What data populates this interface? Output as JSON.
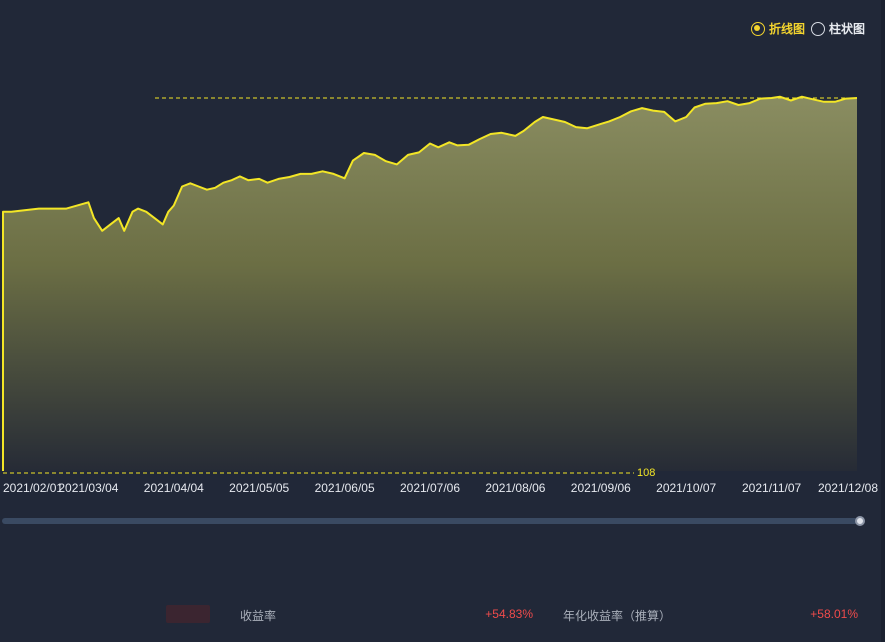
{
  "toggle": {
    "line_label": "折线图",
    "bar_label": "柱状图",
    "selected": "line"
  },
  "colors": {
    "line": "#f3e626",
    "background": "#212838",
    "gain": "#f04b4b"
  },
  "chart_data": {
    "type": "area",
    "ylim": [
      108,
      167
    ],
    "min_label": "108",
    "xticks": [
      "2021/02/01",
      "2021/03/04",
      "2021/04/04",
      "2021/05/05",
      "2021/06/05",
      "2021/07/06",
      "2021/08/06",
      "2021/09/06",
      "2021/10/07",
      "2021/11/07",
      "2021/12/08"
    ],
    "x": [
      "2021/02/01",
      "2021/02/04",
      "2021/02/14",
      "2021/02/24",
      "2021/03/04",
      "2021/03/06",
      "2021/03/09",
      "2021/03/12",
      "2021/03/15",
      "2021/03/17",
      "2021/03/20",
      "2021/03/22",
      "2021/03/25",
      "2021/03/28",
      "2021/03/31",
      "2021/04/02",
      "2021/04/04",
      "2021/04/07",
      "2021/04/10",
      "2021/04/13",
      "2021/04/16",
      "2021/04/19",
      "2021/04/22",
      "2021/04/25",
      "2021/04/28",
      "2021/05/01",
      "2021/05/05",
      "2021/05/08",
      "2021/05/12",
      "2021/05/16",
      "2021/05/20",
      "2021/05/24",
      "2021/05/28",
      "2021/06/01",
      "2021/06/05",
      "2021/06/08",
      "2021/06/12",
      "2021/06/16",
      "2021/06/20",
      "2021/06/24",
      "2021/06/28",
      "2021/07/02",
      "2021/07/06",
      "2021/07/09",
      "2021/07/13",
      "2021/07/16",
      "2021/07/20",
      "2021/07/24",
      "2021/07/28",
      "2021/08/01",
      "2021/08/06",
      "2021/08/09",
      "2021/08/13",
      "2021/08/16",
      "2021/08/20",
      "2021/08/24",
      "2021/08/28",
      "2021/09/01",
      "2021/09/06",
      "2021/09/09",
      "2021/09/13",
      "2021/09/17",
      "2021/09/21",
      "2021/09/25",
      "2021/09/29",
      "2021/10/03",
      "2021/10/07",
      "2021/10/10",
      "2021/10/14",
      "2021/10/18",
      "2021/10/22",
      "2021/10/26",
      "2021/10/30",
      "2021/11/03",
      "2021/11/07",
      "2021/11/10",
      "2021/11/14",
      "2021/11/18",
      "2021/11/22",
      "2021/11/26",
      "2021/11/30",
      "2021/12/04",
      "2021/12/08"
    ],
    "values": [
      149,
      149,
      149.5,
      149.5,
      150.5,
      148,
      146,
      147,
      148,
      146,
      149,
      149.5,
      149,
      148,
      147,
      149,
      150,
      153,
      153.5,
      153,
      152.5,
      152.8,
      153.6,
      154,
      154.6,
      154,
      154.2,
      153.6,
      154.2,
      154.5,
      155,
      155,
      155.4,
      155,
      154.3,
      157.1,
      158.3,
      158,
      157,
      156.5,
      158,
      158.4,
      159.8,
      159.2,
      160,
      159.5,
      159.6,
      160.5,
      161.3,
      161.5,
      161,
      161.8,
      163.2,
      164,
      163.6,
      163.2,
      162.4,
      162.2,
      162.9,
      163.3,
      164,
      164.9,
      165.4,
      165,
      164.8,
      163.3,
      164,
      165.5,
      166.1,
      166.2,
      166.5,
      165.9,
      166.2,
      166.9,
      167,
      167.2,
      166.6,
      167.2,
      166.8,
      166.4,
      166.4,
      166.9,
      167
    ],
    "title": "",
    "xlabel": "",
    "ylabel": ""
  },
  "stats": {
    "return_label": "收益率",
    "return_value": "+54.83%",
    "annual_label": "年化收益率（推算）",
    "annual_value": "+58.01%"
  }
}
